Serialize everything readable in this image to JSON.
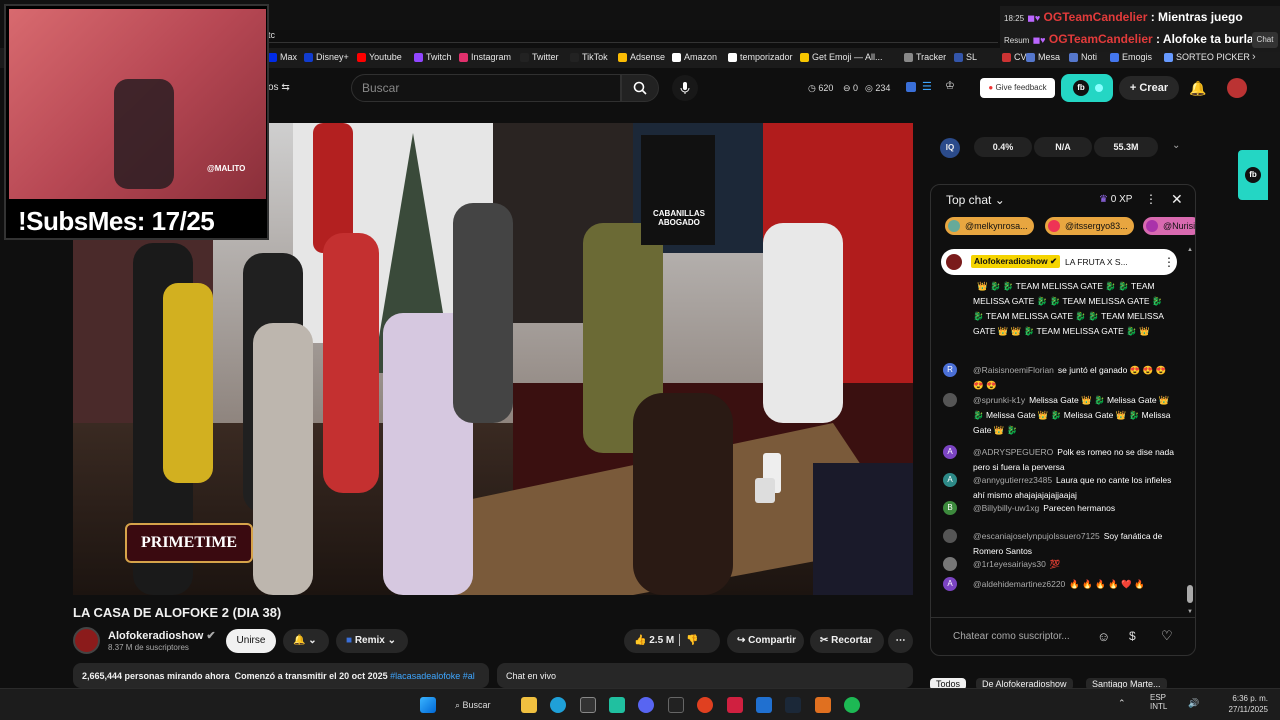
{
  "browser": {
    "tab_partial": "tc",
    "bookmarks": [
      {
        "label": "Max",
        "icon": "max-icon",
        "color": "#002be7"
      },
      {
        "label": "Disney+",
        "icon": "disney-icon",
        "color": "#113ccf"
      },
      {
        "label": "Youtube",
        "icon": "youtube-icon",
        "color": "#ff0000"
      },
      {
        "label": "Twitch",
        "icon": "twitch-icon",
        "color": "#9146ff"
      },
      {
        "label": "Instagram",
        "icon": "instagram-icon",
        "color": "#e1306c"
      },
      {
        "label": "Twitter",
        "icon": "twitter-x-icon",
        "color": "#222222"
      },
      {
        "label": "TikTok",
        "icon": "tiktok-icon",
        "color": "#222222"
      },
      {
        "label": "Adsense",
        "icon": "adsense-icon",
        "color": "#fbbc04"
      },
      {
        "label": "Amazon",
        "icon": "amazon-icon",
        "color": "#ffffff"
      },
      {
        "label": "temporizador",
        "icon": "timer-icon",
        "color": "#ffffff"
      },
      {
        "label": "Get Emoji — All...",
        "icon": "emoji-icon",
        "color": "#f7c600"
      },
      {
        "label": "Tracker",
        "icon": "tracker-icon",
        "color": "#888888"
      },
      {
        "label": "SL",
        "icon": "sl-icon",
        "color": "#3355aa"
      },
      {
        "label": "CV",
        "icon": "cv-icon",
        "color": "#cc3333"
      },
      {
        "label": "Mesa",
        "icon": "mesa-icon",
        "color": "#5577cc"
      },
      {
        "label": "Noti",
        "icon": "noti-icon",
        "color": "#5577cc"
      },
      {
        "label": "Emogis",
        "icon": "emogis-icon",
        "color": "#4477ee"
      },
      {
        "label": "SORTEO PICKER",
        "icon": "sorteo-icon",
        "color": "#6699ff"
      }
    ]
  },
  "stream_overlay": {
    "subs_goal": "!SubsMes: 17/25",
    "cam_watermark": "@MALITO",
    "top_chat": [
      {
        "time": "18:25",
        "user": "OGTeamCandelier",
        "text": ": Mientras juego"
      },
      {
        "time": "Resum",
        "user": "OGTeamCandelier",
        "text": ": Alofoke ta burlao"
      }
    ],
    "top_chat_label": "Chat"
  },
  "header": {
    "search_placeholder": "Buscar",
    "partial_label": "os",
    "stats": {
      "viewers": "620",
      "zero": "0",
      "views": "234"
    },
    "feedback": "Give feedback",
    "create": "Crear"
  },
  "video": {
    "title": "LA CASA DE ALOFOKE 2 (DIA 38)",
    "prime_badge": "PRIMETIME",
    "sign_text": "CABANILLAS\nABOGADO"
  },
  "channel": {
    "name": "Alofokeradioshow",
    "subscribers": "8.37 M de suscriptores",
    "join": "Unirse",
    "remix": "Remix",
    "likes": "2.5 M",
    "share": "Compartir",
    "clip": "Recortar"
  },
  "description": {
    "watching": "2,665,444 personas mirando ahora",
    "started": "Comenzó a transmitir el 20 oct 2025",
    "tags": "#lacasadealofoke #al"
  },
  "chat_live_label": "Chat en vivo",
  "iq_bar": {
    "v1": "0.4%",
    "v2": "N/A",
    "v3": "55.3M"
  },
  "chat": {
    "header": "Top chat",
    "xp": "0 XP",
    "chips": [
      "@melkynrosa...",
      "@itssergyo83...",
      "@Nurisi"
    ],
    "pinned_author": "Alofokeradioshow",
    "pinned_text": "LA FRUTA X S...",
    "messages": [
      {
        "avatar_color": "transparent",
        "avatar": "",
        "author": "",
        "text": "👑 🐉 🐉 TEAM MELISSA GATE 🐉 🐉 TEAM MELISSA GATE 🐉 🐉 TEAM MELISSA GATE 🐉 🐉 TEAM MELISSA GATE 🐉 🐉 TEAM MELISSA GATE 👑 👑 🐉 TEAM MELISSA GATE 🐉 👑"
      },
      {
        "avatar_color": "#4a6fd6",
        "avatar": "R",
        "author": "@RaisisnoemiFlorian",
        "text": "se juntó el ganado 😍 😍 😍 😍 😍"
      },
      {
        "avatar_color": "#555555",
        "avatar": "",
        "author": "@sprunki-k1y",
        "text": "Melissa Gate 👑 🐉 Melissa Gate 👑 🐉 Melissa Gate 👑 🐉 Melissa Gate 👑 🐉 Melissa Gate 👑 🐉"
      },
      {
        "avatar_color": "#7b44c2",
        "avatar": "A",
        "author": "@ADRYSPEGUERO",
        "text": "Polk es romeo no se dise nada pero si fuera la perversa"
      },
      {
        "avatar_color": "#2d8a88",
        "avatar": "A",
        "author": "@annygutierrez3485",
        "text": "Laura que no cante los infieles ahí mismo ahajajajajajjaajaj"
      },
      {
        "avatar_color": "#3d8a3d",
        "avatar": "B",
        "author": "@Billybilly-uw1xg",
        "text": "Parecen hermanos"
      },
      {
        "avatar_color": "#555555",
        "avatar": "",
        "author": "@escaniajoselynpujolssuero7125",
        "text": "Soy fanática de Romero Santos"
      },
      {
        "avatar_color": "#777777",
        "avatar": "",
        "author": "@1r1eyesairiays30",
        "text": "💯"
      },
      {
        "avatar_color": "#7b44c2",
        "avatar": "A",
        "author": "@aldehidemartinez6220",
        "text": "🔥 🔥 🔥 🔥 ❤️ 🔥"
      }
    ],
    "input_placeholder": "Chatear como suscriptor..."
  },
  "chat_tabs": [
    "Todos",
    "De Alofokeradioshow",
    "Santiago Marte..."
  ],
  "taskbar": {
    "search": "Buscar",
    "lang1": "ESP",
    "lang2": "INTL",
    "time": "6:36 p. m.",
    "date": "27/11/2025"
  }
}
